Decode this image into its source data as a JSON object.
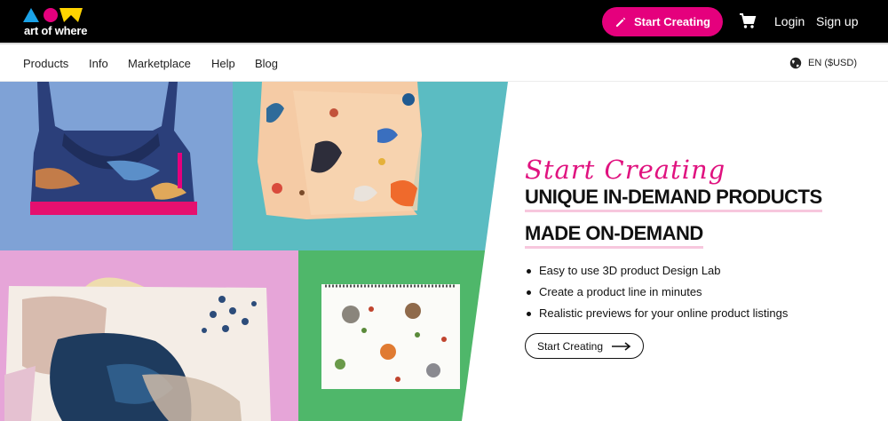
{
  "header": {
    "logo_text": "art of where",
    "logo_colors": [
      "#1ba3e8",
      "#e5007d",
      "#ffd400"
    ],
    "start_creating_label": "Start Creating",
    "cart_icon": "cart-icon",
    "login_label": "Login",
    "signup_label": "Sign up",
    "accent_color": "#e5007d"
  },
  "nav": {
    "items": [
      "Products",
      "Info",
      "Marketplace",
      "Help",
      "Blog"
    ],
    "language_label": "EN ($USD)",
    "language_icon": "globe-icon"
  },
  "hero": {
    "script_title": "Start Creating",
    "headline_line1": "UNIQUE IN-DEMAND PRODUCTS",
    "headline_line2": "MADE ON-DEMAND",
    "bullets": [
      "Easy to use 3D product Design Lab",
      "Create a product line in minutes",
      "Realistic previews for your online product listings"
    ],
    "cta_label": "Start Creating",
    "cta_icon": "arrow-right-icon"
  }
}
